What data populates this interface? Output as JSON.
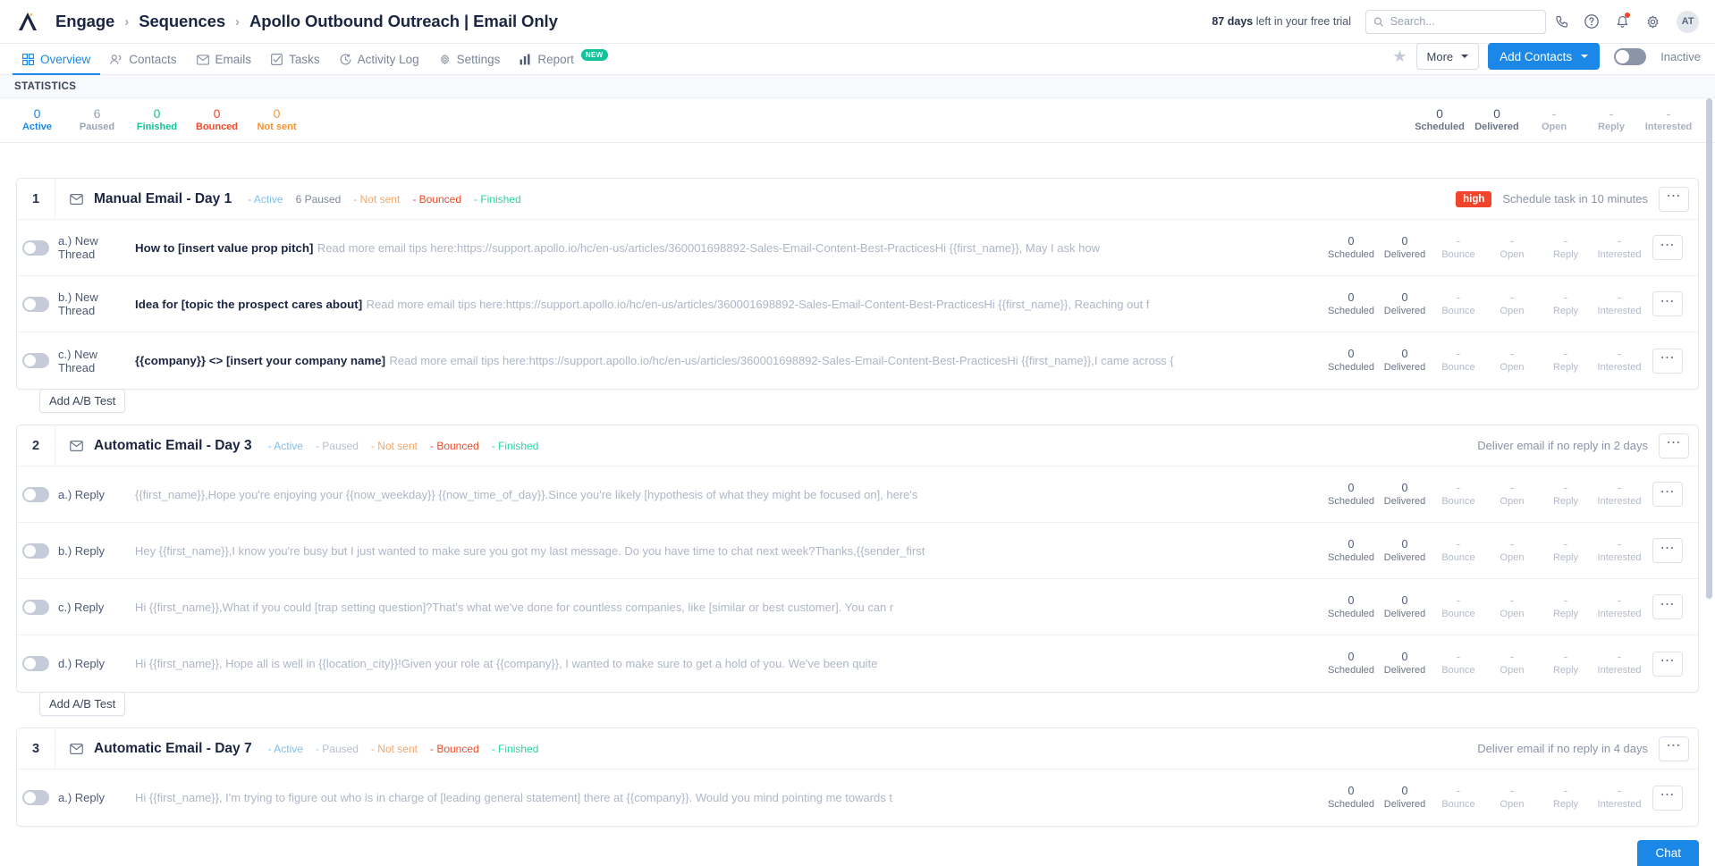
{
  "header": {
    "logo_icon": "apollo-logo-icon",
    "breadcrumb": [
      "Engage",
      "Sequences",
      "Apollo Outbound Outreach | Email Only"
    ],
    "trial_days": "87 days",
    "trial_suffix": " left in your free trial",
    "search_placeholder": "Search...",
    "icons": [
      "phone-icon",
      "help-icon",
      "bell-icon",
      "gear-icon"
    ],
    "avatar_initials": "AT"
  },
  "tabs": [
    {
      "label": "Overview",
      "icon": "grid-icon",
      "active": true,
      "badge": ""
    },
    {
      "label": "Contacts",
      "icon": "people-icon",
      "active": false,
      "badge": ""
    },
    {
      "label": "Emails",
      "icon": "envelope-icon",
      "active": false,
      "badge": ""
    },
    {
      "label": "Tasks",
      "icon": "checklist-icon",
      "active": false,
      "badge": ""
    },
    {
      "label": "Activity Log",
      "icon": "clock-icon",
      "active": false,
      "badge": ""
    },
    {
      "label": "Settings",
      "icon": "gear-icon",
      "active": false,
      "badge": ""
    },
    {
      "label": "Report",
      "icon": "bar-chart-icon",
      "active": false,
      "badge": "NEW"
    }
  ],
  "actions": {
    "star_icon": "star-icon",
    "more_label": "More",
    "add_contacts_label": "Add Contacts",
    "toggle_state": "off",
    "toggle_label": "Inactive"
  },
  "statistics": {
    "title": "STATISTICS",
    "left": [
      {
        "value": "0",
        "label": "Active",
        "color": "#1b87e6"
      },
      {
        "value": "6",
        "label": "Paused",
        "color": "#9aa3b4"
      },
      {
        "value": "0",
        "label": "Finished",
        "color": "#12c29a"
      },
      {
        "value": "0",
        "label": "Bounced",
        "color": "#ef4a2b"
      },
      {
        "value": "0",
        "label": "Not sent",
        "color": "#f59331"
      }
    ],
    "right": [
      {
        "value": "0",
        "label": "Scheduled",
        "dim": false
      },
      {
        "value": "0",
        "label": "Delivered",
        "dim": false
      },
      {
        "value": "-",
        "label": "Open",
        "dim": true
      },
      {
        "value": "-",
        "label": "Reply",
        "dim": true
      },
      {
        "value": "-",
        "label": "Interested",
        "dim": true
      }
    ]
  },
  "row_stat_labels": [
    "Scheduled",
    "Delivered",
    "Bounce",
    "Open",
    "Reply",
    "Interested"
  ],
  "ab_test_label": "Add A/B Test",
  "chat_label": "Chat",
  "steps": [
    {
      "number": "1",
      "title": "Manual Email - Day 1",
      "chips": [
        {
          "text": "- Active",
          "cls": "active"
        },
        {
          "text": "6 Paused",
          "cls": "paused-has"
        },
        {
          "text": "- Not sent",
          "cls": "notsent"
        },
        {
          "text": "- Bounced",
          "cls": "bounced"
        },
        {
          "text": "- Finished",
          "cls": "finished"
        }
      ],
      "priority": "high",
      "meta": "Schedule task in 10 minutes",
      "show_ab": true,
      "rows": [
        {
          "label": "a.) New Thread",
          "subject": "How to [insert value prop pitch]",
          "preview": "Read more email tips here:https://support.apollo.io/hc/en-us/articles/360001698892-Sales-Email-Content-Best-PracticesHi {{first_name}}, May I ask how",
          "stats": [
            "0",
            "0",
            "-",
            "-",
            "-",
            "-"
          ]
        },
        {
          "label": "b.) New Thread",
          "subject": "Idea for [topic the prospect cares about]",
          "preview": "Read more email tips here:https://support.apollo.io/hc/en-us/articles/360001698892-Sales-Email-Content-Best-PracticesHi {{first_name}}, Reaching out f",
          "stats": [
            "0",
            "0",
            "-",
            "-",
            "-",
            "-"
          ]
        },
        {
          "label": "c.) New Thread",
          "subject": "{{company}} <> [insert your company name]",
          "preview": "Read more email tips here:https://support.apollo.io/hc/en-us/articles/360001698892-Sales-Email-Content-Best-PracticesHi {{first_name}},I came across {",
          "stats": [
            "0",
            "0",
            "-",
            "-",
            "-",
            "-"
          ]
        }
      ]
    },
    {
      "number": "2",
      "title": "Automatic Email - Day 3",
      "chips": [
        {
          "text": "- Active",
          "cls": "active"
        },
        {
          "text": "- Paused",
          "cls": "paused"
        },
        {
          "text": "- Not sent",
          "cls": "notsent"
        },
        {
          "text": "- Bounced",
          "cls": "bounced"
        },
        {
          "text": "- Finished",
          "cls": "finished"
        }
      ],
      "priority": "",
      "meta": "Deliver email if no reply in 2 days",
      "show_ab": true,
      "rows": [
        {
          "label": "a.) Reply",
          "subject": "",
          "preview": "{{first_name}},Hope you're enjoying your {{now_weekday}} {{now_time_of_day}}.Since you're likely [hypothesis of what they might be focused on], here's",
          "stats": [
            "0",
            "0",
            "-",
            "-",
            "-",
            "-"
          ]
        },
        {
          "label": "b.) Reply",
          "subject": "",
          "preview": "Hey {{first_name}},I know you're busy but I just wanted to make sure you got my last message. Do you have time to chat next week?Thanks,{{sender_first",
          "stats": [
            "0",
            "0",
            "-",
            "-",
            "-",
            "-"
          ]
        },
        {
          "label": "c.) Reply",
          "subject": "",
          "preview": "Hi {{first_name}},What if you could [trap setting question]?That's what we've done for countless companies, like [similar or best customer]. You can r",
          "stats": [
            "0",
            "0",
            "-",
            "-",
            "-",
            "-"
          ]
        },
        {
          "label": "d.) Reply",
          "subject": "",
          "preview": "Hi {{first_name}}, Hope all is well in {{location_city}}!Given your role at {{company}}, I wanted to make sure to get a hold of you. We've been quite",
          "stats": [
            "0",
            "0",
            "-",
            "-",
            "-",
            "-"
          ]
        }
      ]
    },
    {
      "number": "3",
      "title": "Automatic Email - Day 7",
      "chips": [
        {
          "text": "- Active",
          "cls": "active"
        },
        {
          "text": "- Paused",
          "cls": "paused"
        },
        {
          "text": "- Not sent",
          "cls": "notsent"
        },
        {
          "text": "- Bounced",
          "cls": "bounced"
        },
        {
          "text": "- Finished",
          "cls": "finished"
        }
      ],
      "priority": "",
      "meta": "Deliver email if no reply in 4 days",
      "show_ab": false,
      "rows": [
        {
          "label": "a.) Reply",
          "subject": "",
          "preview": "Hi {{first_name}}, I'm trying to figure out who is in charge of [leading general statement] there at {{company}}. Would you mind pointing me towards t",
          "stats": [
            "0",
            "0",
            "-",
            "-",
            "-",
            "-"
          ]
        }
      ]
    }
  ]
}
